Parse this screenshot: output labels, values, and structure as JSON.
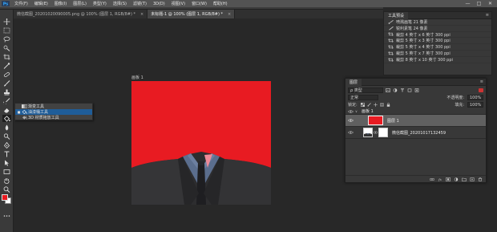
{
  "menubar": {
    "logo_icon": "photoshop-logo-icon",
    "items": [
      "文件(F)",
      "编辑(E)",
      "图像(I)",
      "图层(L)",
      "类型(Y)",
      "选择(S)",
      "滤镜(T)",
      "3D(D)",
      "视图(V)",
      "窗口(W)",
      "帮助(H)"
    ],
    "window_buttons": [
      "—",
      "□",
      "✕"
    ]
  },
  "tabs": [
    {
      "label": "微信截图_20201020090005.png @ 100% (图层 1, RGB/8#) *",
      "close": "×",
      "active": false
    },
    {
      "label": "未标题-1 @ 100% (图层 1, RGB/8#) *",
      "close": "×",
      "active": true
    }
  ],
  "toolbar": {
    "tools": [
      "move-icon",
      "marquee-icon",
      "lasso-icon",
      "quick-select-icon",
      "crop-icon",
      "eyedropper-icon",
      "healing-brush-icon",
      "brush-icon",
      "clone-stamp-icon",
      "history-brush-icon",
      "eraser-icon",
      "paint-bucket-icon",
      "blur-icon",
      "dodge-icon",
      "pen-icon",
      "type-icon",
      "path-select-icon",
      "rectangle-icon",
      "hand-icon",
      "zoom-icon",
      "more-tools-icon"
    ],
    "selected_tool": "paint-bucket-icon",
    "foreground_color": "#e8181f",
    "background_color": "#ffffff"
  },
  "flyout": {
    "items": [
      {
        "label": "渐变工具",
        "icon": "gradient-icon",
        "active": false,
        "mark": ""
      },
      {
        "label": "油漆桶工具",
        "icon": "paint-bucket-icon",
        "active": true,
        "mark": "■"
      },
      {
        "label": "3D 材质拖放工具",
        "icon": "3d-material-drop-icon",
        "active": false,
        "mark": ""
      }
    ]
  },
  "canvas": {
    "artboard_label": "画板 1",
    "background_color": "#e81b22"
  },
  "history": {
    "tab_label": "工具预设",
    "menu": "≡",
    "items": [
      "喷溅画笔 21 像素",
      "锐利素笔 24 像素",
      "裁剪 4 英寸 x 6 英寸 300 ppi",
      "裁剪 5 英寸 x 3 英寸 300 ppi",
      "裁剪 5 英寸 x 4 英寸 300 ppi",
      "裁剪 5 英寸 x 7 英寸 300 ppi",
      "裁剪 8 英寸 x 10 英寸 300 ppi"
    ],
    "item_icons": [
      "spatter-brush-icon",
      "pencil-icon",
      "crop-icon",
      "crop-icon",
      "crop-icon",
      "crop-icon",
      "crop-icon"
    ]
  },
  "layers": {
    "tab_label": "图层",
    "menu": "≡",
    "kind_filter": "ρ 类型",
    "blend_mode": "正常",
    "opacity_label": "不透明度:",
    "opacity_value": "100%",
    "lock_label": "锁定:",
    "fill_label": "填充:",
    "fill_value": "100%",
    "group_caret": "∨",
    "items": [
      {
        "name": "画板 1",
        "type": "artboard-group",
        "visible": true
      },
      {
        "name": "图层 1",
        "type": "layer",
        "selected": true,
        "visible": true
      },
      {
        "name": "微信截图_20201017132459",
        "type": "layer",
        "selected": false,
        "visible": true
      }
    ],
    "footer_icons": [
      "link-layers-icon",
      "fx-icon",
      "add-mask-icon",
      "adjustment-layer-icon",
      "new-group-icon",
      "new-layer-icon",
      "delete-layer-icon"
    ]
  }
}
